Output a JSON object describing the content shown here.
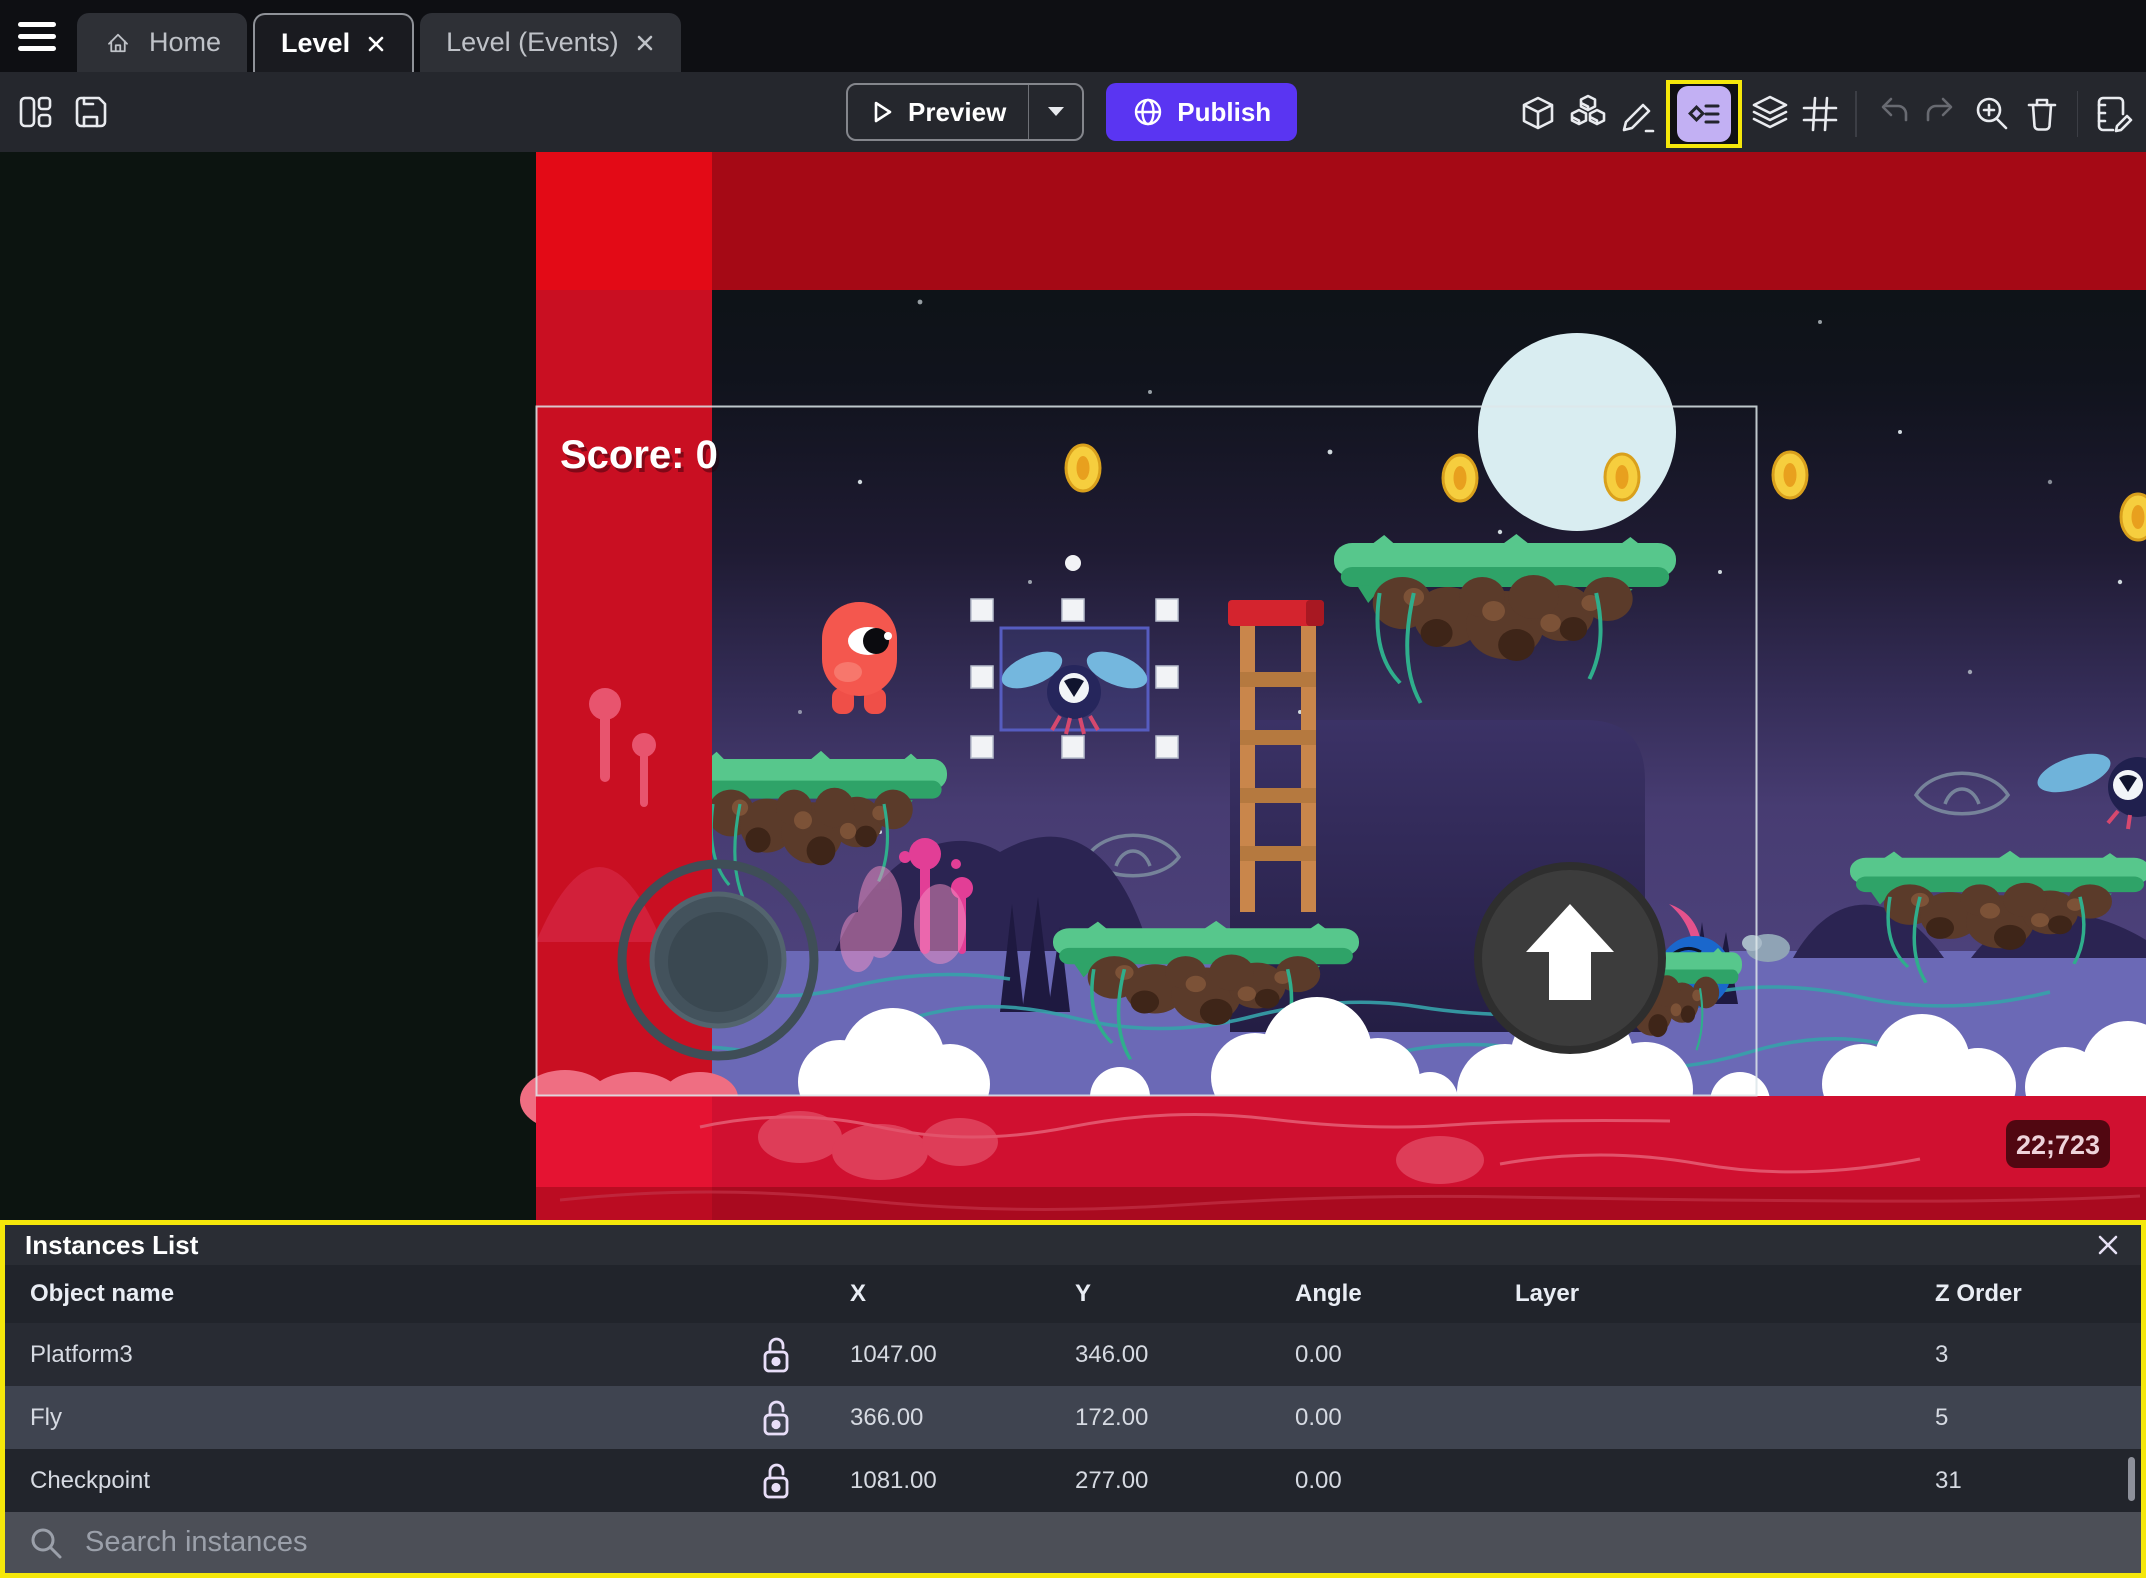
{
  "tabs": {
    "home": "Home",
    "level": "Level",
    "events": "Level (Events)"
  },
  "toolbar": {
    "preview_label": "Preview",
    "publish_label": "Publish",
    "left_icons": [
      "panels",
      "save"
    ],
    "right_icons": [
      "cube-3d",
      "objects",
      "pencil",
      "instances-list",
      "layers",
      "grid",
      "undo",
      "redo",
      "zoom-in",
      "trash",
      "edit-events"
    ],
    "highlighted_icon": "instances-list"
  },
  "canvas": {
    "score_label": "Score: 0",
    "coordinate_badge": "22;723"
  },
  "instances_panel": {
    "title": "Instances List",
    "search_placeholder": "Search instances",
    "columns": {
      "name": "Object name",
      "x": "X",
      "y": "Y",
      "angle": "Angle",
      "layer": "Layer",
      "z_order": "Z Order"
    },
    "rows": [
      {
        "name": "Platform3",
        "x": "1047.00",
        "y": "346.00",
        "angle": "0.00",
        "layer": "",
        "z_order": "3"
      },
      {
        "name": "Fly",
        "x": "366.00",
        "y": "172.00",
        "angle": "0.00",
        "layer": "",
        "z_order": "5"
      },
      {
        "name": "Checkpoint",
        "x": "1081.00",
        "y": "277.00",
        "angle": "0.00",
        "layer": "",
        "z_order": "31"
      }
    ],
    "selected_row": "Fly"
  },
  "colors": {
    "publish_accent": "#5a35f2",
    "highlight_yellow": "#f5e70a",
    "selection_blue": "#565cc0",
    "strip_red": "#c90f22"
  }
}
